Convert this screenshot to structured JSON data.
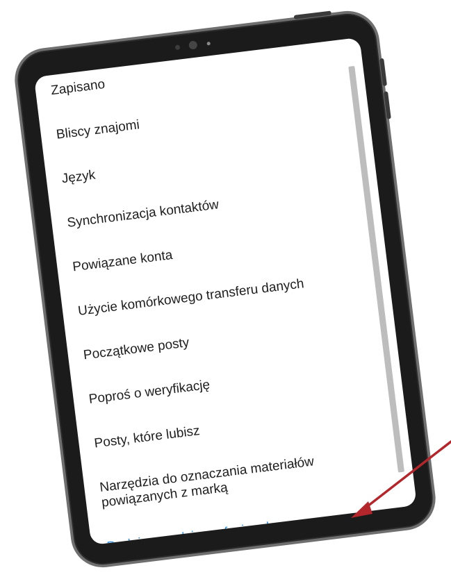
{
  "settings_menu": {
    "items": [
      {
        "label": "Zapisano"
      },
      {
        "label": "Bliscy znajomi"
      },
      {
        "label": "Język"
      },
      {
        "label": "Synchronizacja kontaktów"
      },
      {
        "label": "Powiązane konta"
      },
      {
        "label": "Użycie komórkowego transferu danych"
      },
      {
        "label": "Początkowe posty"
      },
      {
        "label": "Poproś o weryfikację"
      },
      {
        "label": "Posty, które lubisz"
      },
      {
        "label": "Narzędzia do oznaczania materiałów powiązanych z marką"
      },
      {
        "label": "Dodaj narzędzia profesjonalne"
      }
    ]
  },
  "colors": {
    "link": "#2f8fe0",
    "arrow": "#b3262b"
  }
}
